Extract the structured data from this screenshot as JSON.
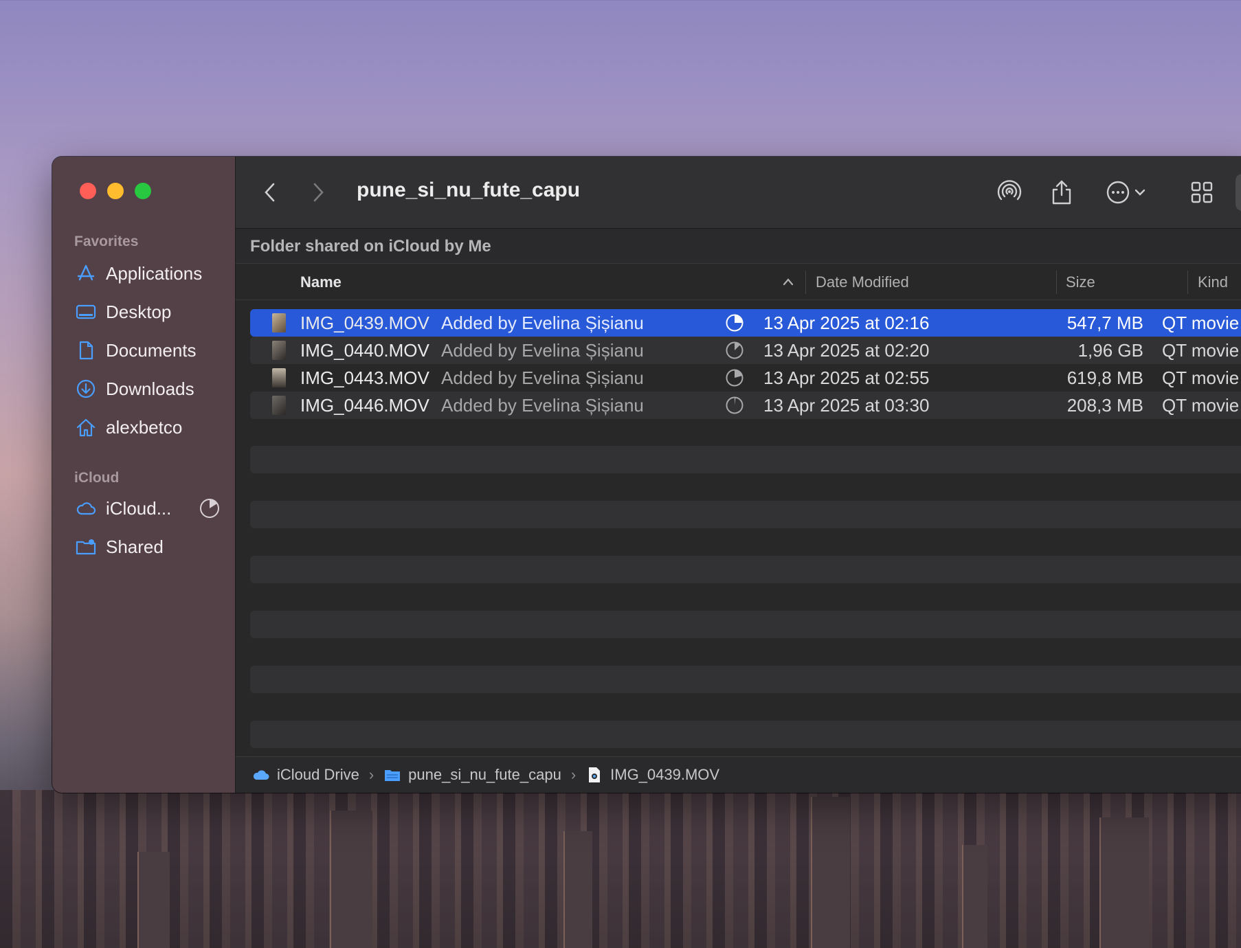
{
  "window": {
    "title": "pune_si_nu_fute_capu",
    "shared_banner": "Folder shared on iCloud by Me"
  },
  "sidebar": {
    "favorites_label": "Favorites",
    "favorites": [
      {
        "label": "Applications",
        "icon": "applications-icon"
      },
      {
        "label": "Desktop",
        "icon": "desktop-icon"
      },
      {
        "label": "Documents",
        "icon": "documents-icon"
      },
      {
        "label": "Downloads",
        "icon": "downloads-icon"
      },
      {
        "label": "alexbetco",
        "icon": "home-icon"
      }
    ],
    "icloud_label": "iCloud",
    "icloud": [
      {
        "label": "iCloud...",
        "icon": "icloud-icon"
      },
      {
        "label": "Shared",
        "icon": "shared-folder-icon"
      }
    ]
  },
  "columns": {
    "name": "Name",
    "date": "Date Modified",
    "size": "Size",
    "kind": "Kind"
  },
  "files": [
    {
      "name": "IMG_0439.MOV",
      "added": "Added by Evelina Șișianu",
      "date": "13 Apr 2025 at 02:16",
      "size": "547,7 MB",
      "kind": "QT movie",
      "upload_progress": 0.3
    },
    {
      "name": "IMG_0440.MOV",
      "added": "Added by Evelina Șișianu",
      "date": "13 Apr 2025 at 02:20",
      "size": "1,96 GB",
      "kind": "QT movie",
      "upload_progress": 0.15
    },
    {
      "name": "IMG_0443.MOV",
      "added": "Added by Evelina Șișianu",
      "date": "13 Apr 2025 at 02:55",
      "size": "619,8 MB",
      "kind": "QT movie",
      "upload_progress": 0.3
    },
    {
      "name": "IMG_0446.MOV",
      "added": "Added by Evelina Șișianu",
      "date": "13 Apr 2025 at 03:30",
      "size": "208,3 MB",
      "kind": "QT movie",
      "upload_progress": 0.02
    }
  ],
  "pathbar": {
    "root": "iCloud Drive",
    "folder": "pune_si_nu_fute_capu",
    "file": "IMG_0439.MOV"
  },
  "colors": {
    "selection": "#2759d8",
    "accent": "#4a9eff",
    "red": "#ff5f57",
    "yellow": "#febc2e",
    "green": "#28c840"
  }
}
